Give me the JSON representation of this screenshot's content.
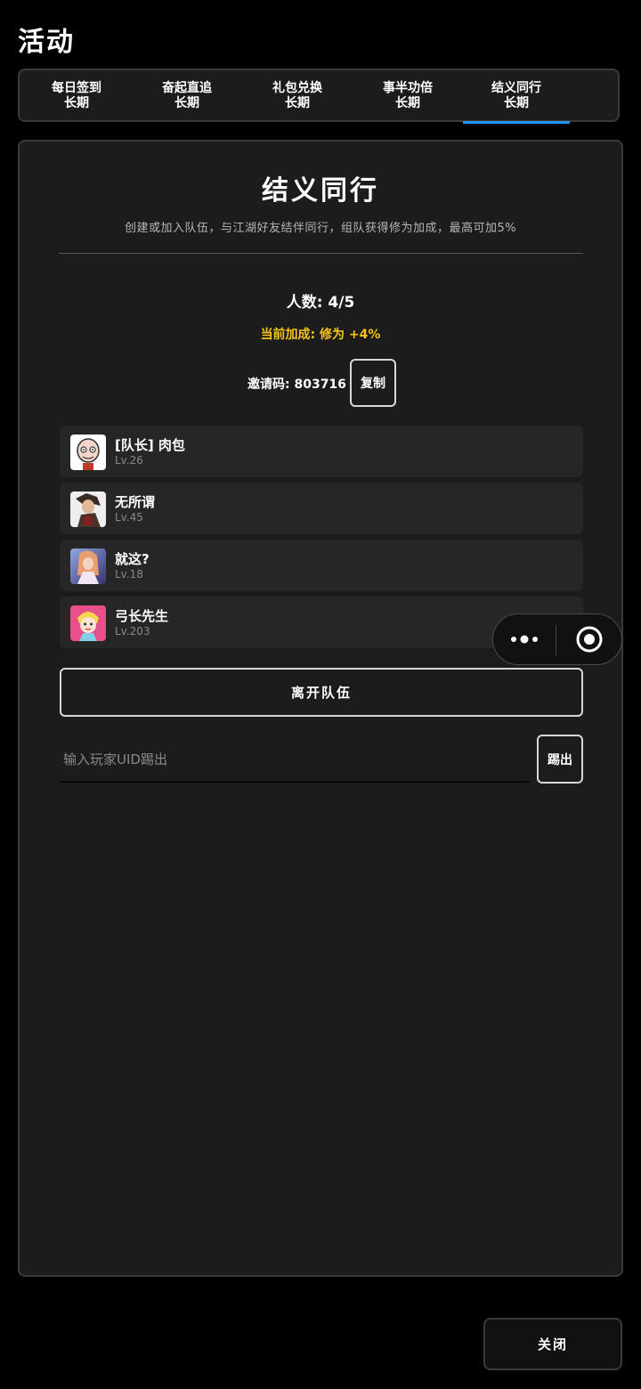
{
  "header": {
    "title": "活动"
  },
  "tabs": [
    {
      "label": "每日签到",
      "period": "长期",
      "active": false
    },
    {
      "label": "奋起直追",
      "period": "长期",
      "active": false
    },
    {
      "label": "礼包兑换",
      "period": "长期",
      "active": false
    },
    {
      "label": "事半功倍",
      "period": "长期",
      "active": false
    },
    {
      "label": "结义同行",
      "period": "长期",
      "active": true
    }
  ],
  "panel": {
    "title": "结义同行",
    "subtitle": "创建或加入队伍，与江湖好友结伴同行，组队获得修为加成，最高可加5%",
    "count_text": "人数: 4/5",
    "bonus_text": "当前加成: 修为 +4%",
    "invite_text": "邀请码: 803716",
    "copy_label": "复制"
  },
  "members": [
    {
      "name": "[队长] 肉包",
      "level": "Lv.26",
      "avatar": "bald-cartoon-face-avatar-icon"
    },
    {
      "name": "无所谓",
      "level": "Lv.45",
      "avatar": "anime-character-avatar-icon"
    },
    {
      "name": "就这?",
      "level": "Lv.18",
      "avatar": "anime-girl-avatar-icon"
    },
    {
      "name": "弓长先生",
      "level": "Lv.203",
      "avatar": "pink-cartoon-avatar-icon"
    }
  ],
  "actions": {
    "leave_label": "离开队伍",
    "kick_placeholder": "输入玩家UID踢出",
    "kick_label": "踢出",
    "close_label": "关闭"
  },
  "colors": {
    "background": "#000000",
    "panel": "#1c1c1c",
    "card": "#262626",
    "accent": "#2196f3",
    "bonus": "#f5c518",
    "border": "#3a3a3a"
  }
}
